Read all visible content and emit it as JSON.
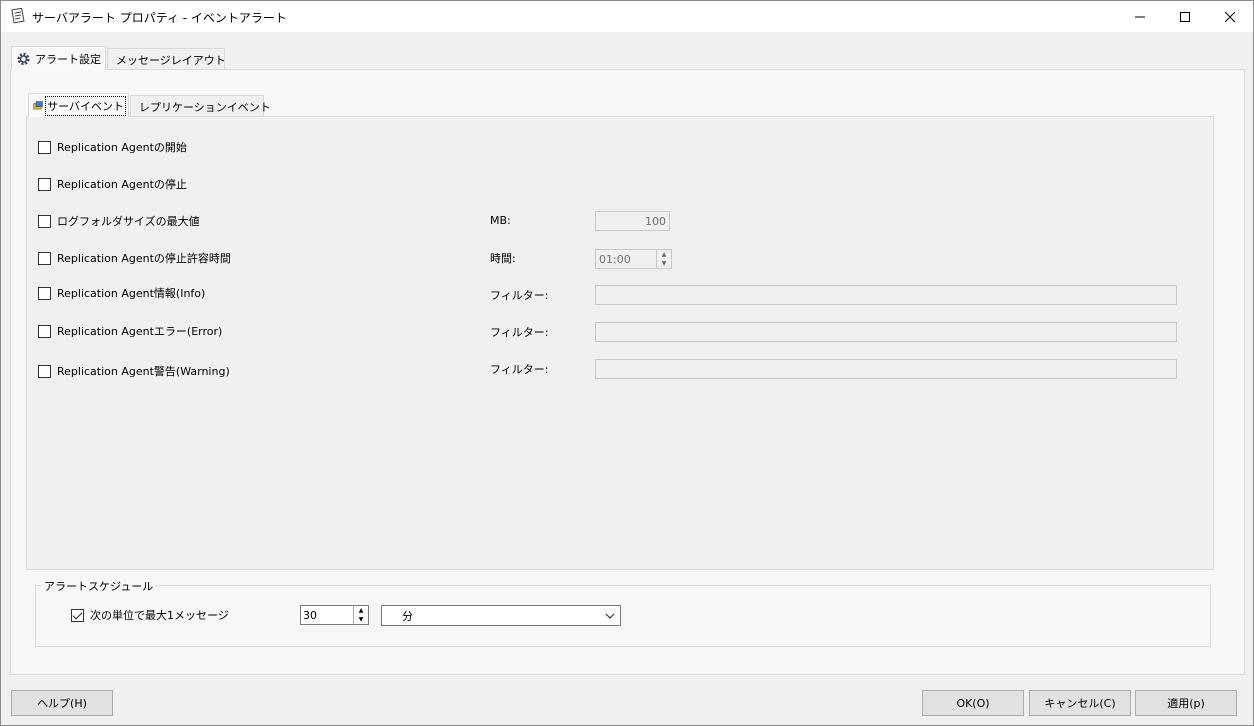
{
  "window": {
    "title": "サーバアラート プロパティ - イベントアラート",
    "minimize_glyph": "—",
    "maximize_glyph": "☐",
    "close_glyph": "✕"
  },
  "outer_tabs": [
    {
      "label": "アラート設定",
      "icon": "gear-icon",
      "active": true
    },
    {
      "label": "メッセージレイアウト",
      "icon": "document-icon",
      "active": false
    }
  ],
  "inner_tabs": [
    {
      "label": "サーバイベント",
      "icon": "server-event-icon",
      "active": true
    },
    {
      "label": "レプリケーションイベント",
      "icon": "replication-event-icon",
      "active": false
    }
  ],
  "events": [
    {
      "label": "Replication Agentの開始",
      "checked": false
    },
    {
      "label": "Replication Agentの停止",
      "checked": false
    },
    {
      "label": "ログフォルダサイズの最大値",
      "checked": false,
      "field_label": "MB:",
      "field_value": "100"
    },
    {
      "label": "Replication Agentの停止許容時間",
      "checked": false,
      "field_label": "時間:",
      "field_value": "01:00"
    },
    {
      "label": "Replication Agent情報(Info)",
      "checked": false,
      "field_label": "フィルター:",
      "field_value": ""
    },
    {
      "label": "Replication Agentエラー(Error)",
      "checked": false,
      "field_label": "フィルター:",
      "field_value": ""
    },
    {
      "label": "Replication Agent警告(Warning)",
      "checked": false,
      "field_label": "フィルター:",
      "field_value": ""
    }
  ],
  "schedule": {
    "group_label": "アラートスケジュール",
    "checkbox_label": "次の単位で最大1メッセージ",
    "checked": true,
    "interval_value": "30",
    "unit_value": "分"
  },
  "buttons": {
    "help": "ヘルプ(H)",
    "ok": "OK(O)",
    "cancel": "キャンセル(C)",
    "apply": "適用(p)"
  }
}
